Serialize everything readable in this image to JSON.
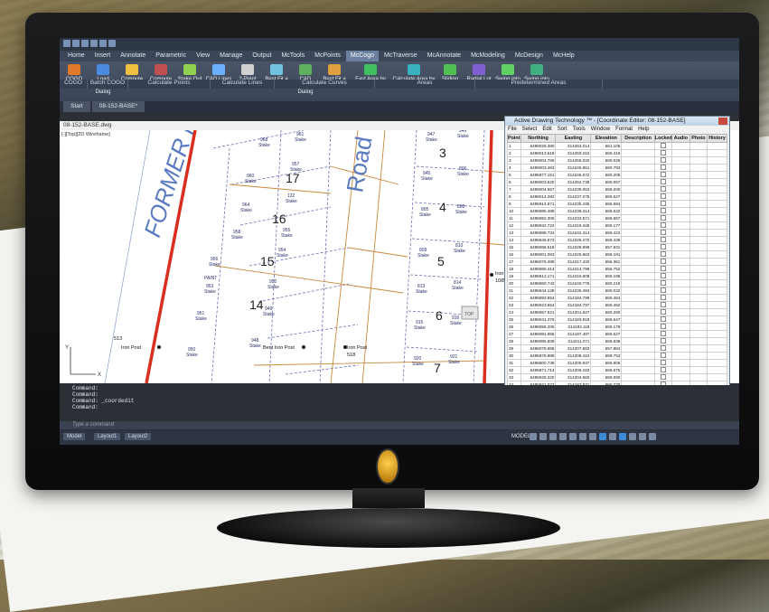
{
  "app": {
    "window_title": "",
    "quick_access_icons": [
      "new-icon",
      "open-icon",
      "save-icon",
      "undo-icon",
      "redo-icon",
      "print-icon"
    ]
  },
  "ribbon": {
    "tabs": [
      "Home",
      "Insert",
      "Annotate",
      "Parametric",
      "View",
      "Manage",
      "Output",
      "McTools",
      "McPoints",
      "McCogo",
      "McTraverse",
      "McAnnotate",
      "McModeling",
      "McDesign",
      "McHelp"
    ],
    "active_tab": "McCogo",
    "buttons": [
      {
        "label": "COGO",
        "icon": "cogo-icon"
      },
      {
        "label": "Load Control Dialog",
        "icon": "load-control-icon"
      },
      {
        "label": "Compute Points",
        "icon": "compute-points-icon"
      },
      {
        "label": "Compute Stakes",
        "icon": "compute-stakes-icon"
      },
      {
        "label": "Stake Out Points",
        "icon": "stake-out-icon"
      },
      {
        "label": "CAD Lines Dialog",
        "icon": "cad-lines-icon"
      },
      {
        "label": "2-Point Inverse",
        "icon": "inverse-icon"
      },
      {
        "label": "Best Fit a Line",
        "icon": "best-fit-line-icon"
      },
      {
        "label": "CAD Curves Dialog",
        "icon": "cad-curves-icon"
      },
      {
        "label": "Best Fit a Curve",
        "icon": "best-fit-curve-icon"
      },
      {
        "label": "Fast Area by Selecting Objects",
        "icon": "fast-area-icon"
      },
      {
        "label": "Calculate Area by Point Numbers",
        "icon": "area-points-icon"
      },
      {
        "label": "Sliding Bearing",
        "icon": "sliding-bearing-icon"
      },
      {
        "label": "Radial Lot Line",
        "icon": "radial-lot-icon"
      },
      {
        "label": "Swing into a Line",
        "icon": "swing-line-icon"
      },
      {
        "label": "Swing into a Curve",
        "icon": "swing-curve-icon"
      }
    ],
    "groups": [
      "COGO",
      "Batch COGO",
      "Calculate Points",
      "Calculate Lines",
      "Calculate Curves",
      "Areas",
      "Predetermined Areas"
    ]
  },
  "doc_tabs": [
    "Start",
    "08-152-BASE*"
  ],
  "drawing": {
    "file_name": "08-152-BASE.dwg",
    "viewport_label": "[-][Top][2D Wireframe]",
    "road_texts": [
      "FORMER F",
      "Road"
    ],
    "lot_numbers": [
      "17",
      "16",
      "15",
      "14",
      "3",
      "4",
      "5",
      "6",
      "7"
    ],
    "stake_label": "Stake",
    "point_numbers": [
      "968",
      "961",
      "960",
      "957",
      "964",
      "122",
      "958",
      "955",
      "956",
      "954",
      "953",
      "952",
      "951",
      "949",
      "950",
      "948",
      "947",
      "946",
      "945",
      "806",
      "805",
      "808",
      "809",
      "810",
      "813",
      "814",
      "915",
      "916",
      "920",
      "921",
      "923",
      "924",
      "925",
      "907",
      "905"
    ],
    "text_iron_post_1": "Iron Post",
    "text_iron_post_2": "Bent Iron Post",
    "text_iron_post_3": "Iron Post",
    "text_iron_post_4": "Iron Post",
    "num_1085": "1085",
    "num_518": "518",
    "num_513": "513",
    "num_128": "128",
    "num_124": "124",
    "num_120": "120",
    "num_110": "110",
    "num_109": "109",
    "num_108": "108",
    "num_107": "107",
    "num_205": "205",
    "paint_label": "PAINT",
    "axis_x": "X",
    "axis_y": "Y",
    "top_btn": "TOP"
  },
  "coord_editor": {
    "title": "Active Drawing Technology ™ - [Coordinate Editor: 08-152-BASE]",
    "menu": [
      "File",
      "Select",
      "Edit",
      "Sort",
      "Tools",
      "Window",
      "Format",
      "Help"
    ],
    "columns": [
      "Point",
      "Northing",
      "Easting",
      "Elevation",
      "Description",
      "Locked",
      "Audio",
      "Photo",
      "History"
    ],
    "rows": [
      [
        "1",
        "5496029.380",
        "314263.014",
        "561.105"
      ],
      [
        "2",
        "5496013.618",
        "314250.152",
        "560.419"
      ],
      [
        "3",
        "5496004.769",
        "314255.020",
        "560.025"
      ],
      [
        "4",
        "5496003.463",
        "314246.651",
        "560.793"
      ],
      [
        "5",
        "5495977.151",
        "314245.672",
        "560.206"
      ],
      [
        "6",
        "5496003.520",
        "314252.738",
        "560.057"
      ],
      [
        "7",
        "5496004.657",
        "314239.053",
        "559.200"
      ],
      [
        "8",
        "5496014.282",
        "314237.075",
        "559.527"
      ],
      [
        "9",
        "5495914.671",
        "314235.435",
        "558.594"
      ],
      [
        "10",
        "5495985.489",
        "314236.414",
        "558.632"
      ],
      [
        "11",
        "5495992.306",
        "314232.571",
        "559.657"
      ],
      [
        "12",
        "5495932.722",
        "314216.426",
        "559.177"
      ],
      [
        "13",
        "5495988.734",
        "314242.314",
        "559.422"
      ],
      [
        "14",
        "5495948.673",
        "314226.470",
        "558.436"
      ],
      [
        "15",
        "5496068.518",
        "314228.999",
        "557.931"
      ],
      [
        "16",
        "5496001.063",
        "314225.563",
        "558.181"
      ],
      [
        "17",
        "5496076.489",
        "314217.420",
        "556.361"
      ],
      [
        "18",
        "5495980.414",
        "314214.799",
        "556.752"
      ],
      [
        "19",
        "5495812.171",
        "314216.609",
        "559.195"
      ],
      [
        "20",
        "5495960.742",
        "314240.776",
        "560.215"
      ],
      [
        "21",
        "5495944.128",
        "314235.494",
        "560.032"
      ],
      [
        "22",
        "5495893.654",
        "314184.799",
        "560.464"
      ],
      [
        "23",
        "5495923.654",
        "314184.797",
        "560.462"
      ],
      [
        "24",
        "5495957.521",
        "314201.627",
        "560.260"
      ],
      [
        "25",
        "5496041.376",
        "314183.919",
        "559.647"
      ],
      [
        "26",
        "5496056.205",
        "314193.118",
        "559.179"
      ],
      [
        "27",
        "5496081.958",
        "314197.487",
        "559.527"
      ],
      [
        "28",
        "5496085.509",
        "314211.071",
        "558.838"
      ],
      [
        "29",
        "5496078.658",
        "314207.683",
        "557.884"
      ],
      [
        "30",
        "5495978.989",
        "314208.424",
        "559.753"
      ],
      [
        "31",
        "5495800.739",
        "314200.937",
        "559.906"
      ],
      [
        "32",
        "5495871.714",
        "314206.183",
        "559.675"
      ],
      [
        "33",
        "5495928.320",
        "314204.660",
        "559.080"
      ],
      [
        "34",
        "5495821.077",
        "314187.931",
        "560.778"
      ],
      [
        "35",
        "5495831.461",
        "314205.302",
        "560.674"
      ],
      [
        "36",
        "5495421.092",
        "314455.004",
        "0.000"
      ],
      [
        "37",
        "5495286.163",
        "314490.046",
        "0.000"
      ],
      [
        "38",
        "5496246.248",
        "314543.232",
        "0.000"
      ],
      [
        "39",
        "5496874.260",
        "314196.338",
        "561.143"
      ]
    ]
  },
  "command": {
    "history": [
      "Command:",
      "Command:",
      "Command: _coordedit",
      "Command:"
    ],
    "placeholder": "Type a command"
  },
  "status": {
    "layout_tabs": [
      "Model",
      "Layout1",
      "Layout2"
    ],
    "model_label": "MODEL",
    "scale": "1:1"
  },
  "colors": {
    "road": "#d82f1f",
    "lot_line": "#c8893a",
    "plat_line": "#6a6fb5",
    "accent": "#3a78c8"
  }
}
